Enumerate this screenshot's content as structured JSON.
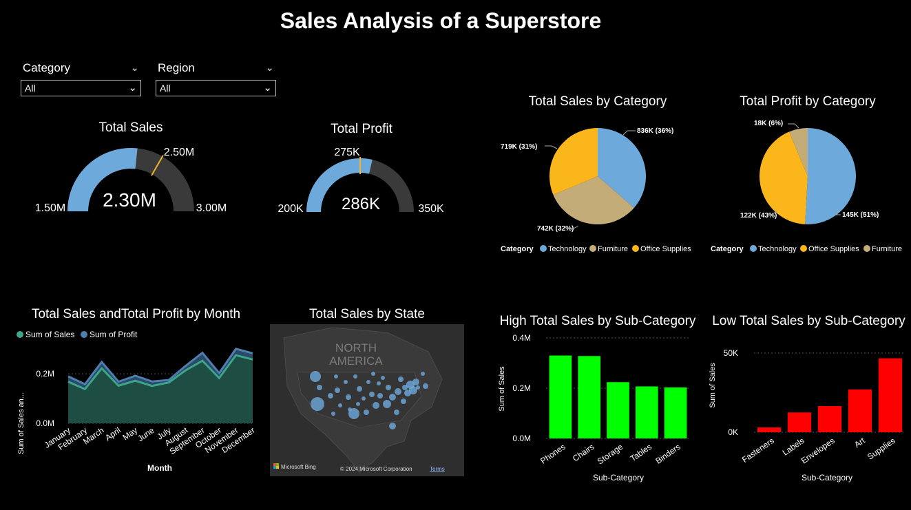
{
  "title": "Sales Analysis of a Superstore",
  "slicers": [
    {
      "label": "Category",
      "value": "All"
    },
    {
      "label": "Region",
      "value": "All"
    }
  ],
  "gauges": {
    "sales": {
      "title": "Total Sales",
      "value": 2.3,
      "value_label": "2.30M",
      "min_label": "1.50M",
      "max_label": "3.00M",
      "target_label": "2.50M",
      "min": 1.5,
      "max": 3.0,
      "target": 2.5
    },
    "profit": {
      "title": "Total Profit",
      "value": 286,
      "value_label": "286K",
      "min_label": "200K",
      "max_label": "350K",
      "target_label": "275K",
      "min": 200,
      "max": 350,
      "target": 275
    }
  },
  "colors": {
    "technology": "#6EA9DB",
    "furniture": "#C4AC78",
    "office_supplies": "#FBB61C",
    "area_sales": "#1E4D43",
    "area_profit": "#2A4A6A",
    "line_sales": "#3DA58A",
    "line_profit": "#4E7FAF",
    "green_bar": "#00FF00",
    "red_bar": "#FF0000",
    "gauge_fill": "#6EA9DB",
    "gauge_track": "#3A3A3A",
    "gauge_target": "#F0B429"
  },
  "chart_data": [
    {
      "type": "pie",
      "title": "Total Sales by Category",
      "legend_title": "Category",
      "slices": [
        {
          "name": "Technology",
          "value": 836,
          "label": "836K (36%)",
          "color": "#6EA9DB"
        },
        {
          "name": "Furniture",
          "value": 742,
          "label": "742K (32%)",
          "color": "#C4AC78"
        },
        {
          "name": "Office Supplies",
          "value": 719,
          "label": "719K (31%)",
          "color": "#FBB61C"
        }
      ],
      "legend": [
        "Technology",
        "Furniture",
        "Office Supplies"
      ]
    },
    {
      "type": "pie",
      "title": "Total Profit by Category",
      "legend_title": "Category",
      "slices": [
        {
          "name": "Technology",
          "value": 145,
          "label": "145K (51%)",
          "color": "#6EA9DB"
        },
        {
          "name": "Office Supplies",
          "value": 122,
          "label": "122K (43%)",
          "color": "#FBB61C"
        },
        {
          "name": "Furniture",
          "value": 18,
          "label": "18K (6%)",
          "color": "#C4AC78"
        }
      ],
      "legend": [
        "Technology",
        "Office Supplies",
        "Furniture"
      ]
    },
    {
      "type": "area",
      "title": "Total Sales andTotal Profit by Month",
      "xlabel": "Month",
      "ylabel": "Sum of Sales an...",
      "categories": [
        "January",
        "February",
        "March",
        "April",
        "May",
        "June",
        "July",
        "August",
        "September",
        "October",
        "November",
        "December"
      ],
      "series": [
        {
          "name": "Sum of Sales",
          "values": [
            0.168,
            0.138,
            0.222,
            0.152,
            0.172,
            0.151,
            0.165,
            0.214,
            0.253,
            0.183,
            0.275,
            0.258
          ]
        },
        {
          "name": "Sum of Profit",
          "values": [
            0.19,
            0.158,
            0.248,
            0.168,
            0.192,
            0.169,
            0.175,
            0.232,
            0.285,
            0.203,
            0.301,
            0.283
          ]
        }
      ],
      "yticks": [
        "0.0M",
        "0.2M"
      ],
      "ylim": [
        0,
        0.32
      ]
    },
    {
      "type": "bar",
      "title": "High Total Sales by Sub-Category",
      "xlabel": "Sub-Category",
      "ylabel": "Sum of Sales",
      "categories": [
        "Phones",
        "Chairs",
        "Storage",
        "Tables",
        "Binders"
      ],
      "values": [
        0.33,
        0.328,
        0.224,
        0.207,
        0.203
      ],
      "yticks": [
        "0.0M",
        "0.2M",
        "0.4M"
      ],
      "ylim": [
        0,
        0.4
      ],
      "color": "#00FF00"
    },
    {
      "type": "bar",
      "title": "Low Total Sales by Sub-Category",
      "xlabel": "Sub-Category",
      "ylabel": "Sum of Sales",
      "categories": [
        "Fasteners",
        "Labels",
        "Envelopes",
        "Art",
        "Supplies"
      ],
      "values": [
        3,
        12.5,
        16.5,
        27,
        46.7
      ],
      "yticks": [
        "0K",
        "50K"
      ],
      "ylim": [
        0,
        50
      ],
      "color": "#FF0000"
    }
  ],
  "map": {
    "title": "Total Sales by State",
    "region_label_1": "NORTH",
    "region_label_2": "AMERICA",
    "provider": "Microsoft Bing",
    "copyright": "© 2024 Microsoft Corporation",
    "terms": "Terms"
  }
}
